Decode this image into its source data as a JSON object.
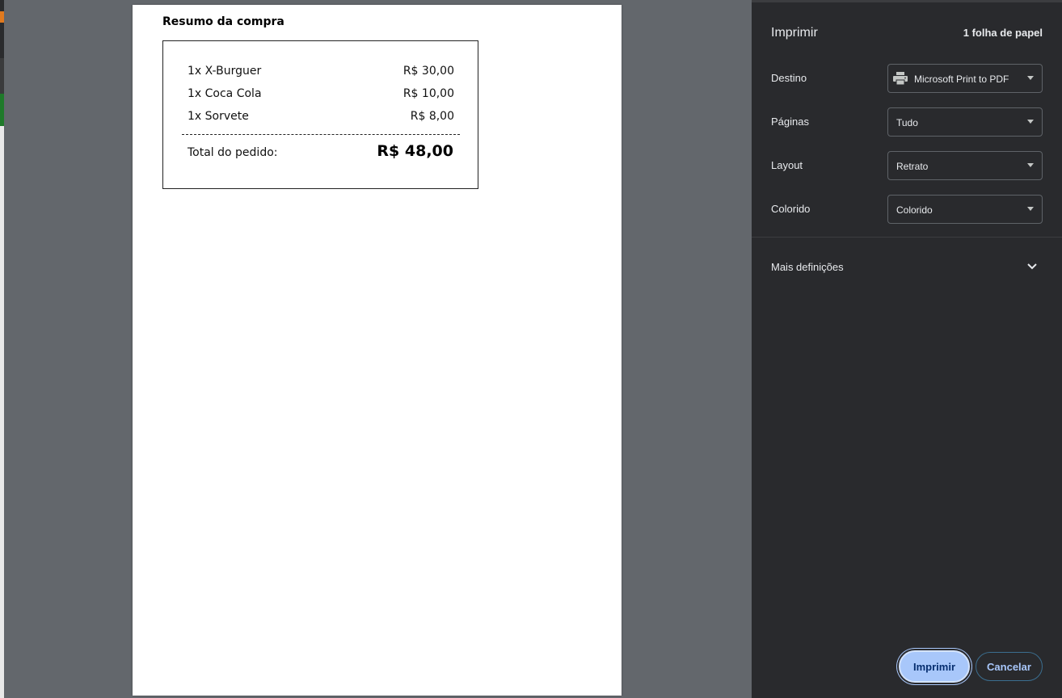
{
  "receipt": {
    "title": "Resumo da compra",
    "items": [
      {
        "name": "1x X-Burguer",
        "price": "R$ 30,00"
      },
      {
        "name": "1x Coca Cola",
        "price": "R$ 10,00"
      },
      {
        "name": "1x Sorvete",
        "price": "R$ 8,00"
      }
    ],
    "total_label": "Total do pedido:",
    "total_value": "R$ 48,00"
  },
  "sidebar": {
    "title": "Imprimir",
    "sheet_count": "1 folha de papel",
    "destination": {
      "label": "Destino",
      "value": "Microsoft Print to PDF",
      "icon": "printer-icon"
    },
    "pages": {
      "label": "Páginas",
      "value": "Tudo"
    },
    "layout": {
      "label": "Layout",
      "value": "Retrato"
    },
    "color": {
      "label": "Colorido",
      "value": "Colorido"
    },
    "more_settings": "Mais definições",
    "print_button": "Imprimir",
    "cancel_button": "Cancelar"
  },
  "colors": {
    "sidebar_bg": "#292a2d",
    "preview_bg": "#63676c",
    "primary_button": "#a8c7fa",
    "primary_button_text": "#062e6f"
  }
}
